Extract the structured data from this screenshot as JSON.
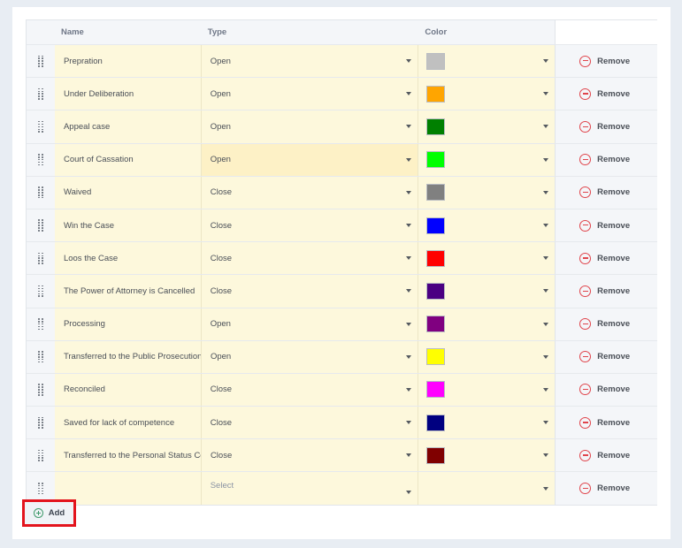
{
  "table": {
    "headers": {
      "name": "Name",
      "type": "Type",
      "color": "Color"
    },
    "remove_label": "Remove",
    "type_placeholder": "Select",
    "rows": [
      {
        "name": "Prepration",
        "type": "Open",
        "color": "#c0c0c0"
      },
      {
        "name": "Under Deliberation",
        "type": "Open",
        "color": "#ffa500"
      },
      {
        "name": "Appeal case",
        "type": "Open",
        "color": "#008000"
      },
      {
        "name": "Court of Cassation",
        "type": "Open",
        "color": "#00ff00"
      },
      {
        "name": "Waived",
        "type": "Close",
        "color": "#808080"
      },
      {
        "name": "Win the Case",
        "type": "Close",
        "color": "#0000ff"
      },
      {
        "name": "Loos the Case",
        "type": "Close",
        "color": "#ff0000"
      },
      {
        "name": "The Power of Attorney is Cancelled",
        "type": "Close",
        "color": "#4b0082"
      },
      {
        "name": "Processing",
        "type": "Open",
        "color": "#800080"
      },
      {
        "name": "Transferred to the Public Prosecution",
        "type": "Open",
        "color": "#ffff00"
      },
      {
        "name": "Reconciled",
        "type": "Close",
        "color": "#ff00ff"
      },
      {
        "name": "Saved for lack of competence",
        "type": "Close",
        "color": "#000080"
      },
      {
        "name": "Transferred to the Personal Status Court",
        "type": "Close",
        "color": "#800000"
      },
      {
        "name": "",
        "type": "",
        "color": ""
      }
    ]
  },
  "add_label": "Add",
  "icons": {
    "handle": "drag-handle-icon",
    "remove": "minus-circle-icon",
    "add": "plus-circle-icon",
    "caret": "chevron-down-icon"
  },
  "colors": {
    "row_background": "#fdf8dc",
    "remove_accent": "#e0454c",
    "add_accent": "#3f9a6b",
    "highlight_border": "#e3141d"
  }
}
